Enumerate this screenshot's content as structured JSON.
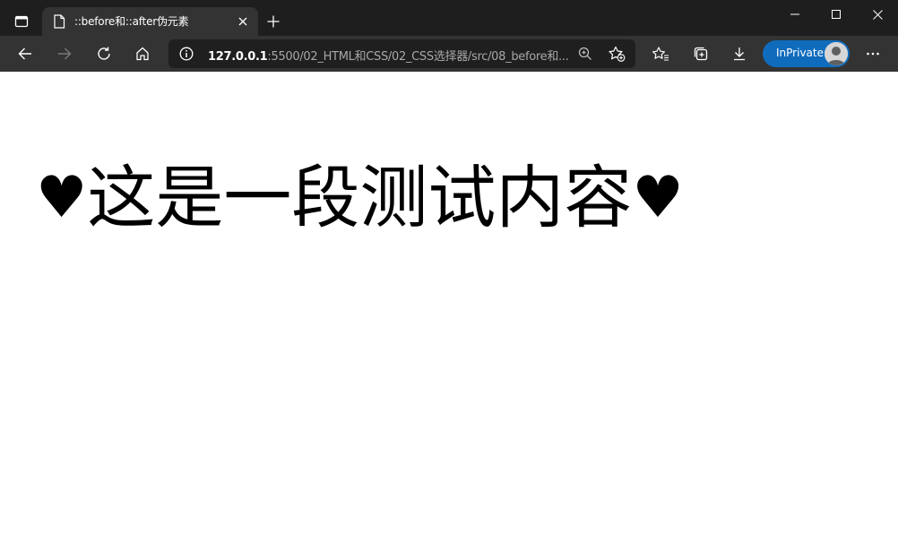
{
  "browser": {
    "tab": {
      "title": "::before和::after伪元素",
      "close_symbol": "✕"
    },
    "new_tab_symbol": "+",
    "address": {
      "host": "127.0.0.1",
      "rest": ":5500/02_HTML和CSS/02_CSS选择器/src/08_before和..."
    },
    "inprivate_label": "InPrivate",
    "more_symbol": "···"
  },
  "page": {
    "before_content": "♥",
    "paragraph_text": "这是一段测试内容",
    "after_content": "♥"
  },
  "colors": {
    "titlebar": "#1e1e1e",
    "toolbar": "#333333",
    "accent": "#0f6cbd",
    "text": "#000000"
  }
}
